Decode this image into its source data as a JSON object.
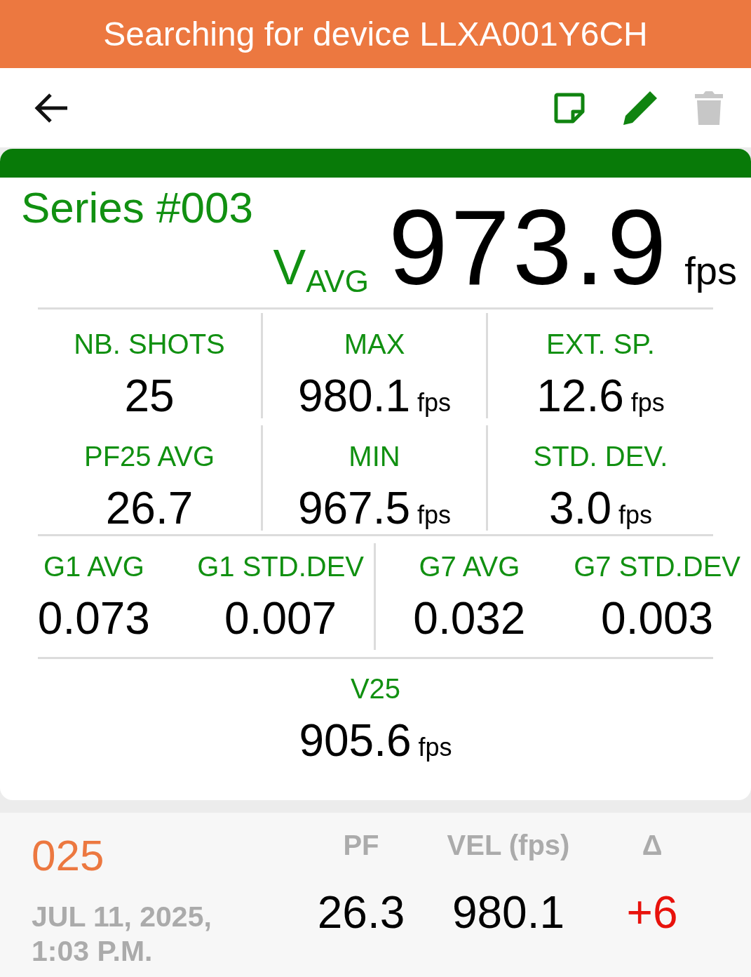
{
  "banner": {
    "text": "Searching for device LLXA001Y6CH"
  },
  "series": {
    "title": "Series #003",
    "average_label": "V$_{AVG}$",
    "average_value": "973.9",
    "average_unit": "fps"
  },
  "stats": [
    {
      "label": "NB. SHOTS",
      "value": "25"
    },
    {
      "label": "MAX",
      "value": "980.1",
      "unit": "fps"
    },
    {
      "label": "EXT. SP.",
      "value": "12.6",
      "unit": "fps"
    },
    {
      "label": "PF25 AVG",
      "value": "26.7"
    },
    {
      "label": "MIN",
      "value": "967.5",
      "unit": "fps"
    },
    {
      "label": "STD. DEV.",
      "value": "3.0",
      "unit": "fps"
    }
  ],
  "drag_stats": [
    {
      "label": "G1 AVG",
      "value": "0.073"
    },
    {
      "label": "G1 STD.DEV",
      "value": "0.007"
    },
    {
      "label": "G7 AVG",
      "value": "0.032"
    },
    {
      "label": "G7 STD.DEV",
      "value": "0.003"
    }
  ],
  "v25": {
    "label": "V25",
    "value": "905.6",
    "unit": "fps"
  },
  "shot": {
    "number": "025",
    "date": "JUL 11, 2025, 1:03 P.M.",
    "columns": [
      {
        "header": "PF",
        "value": "26.3",
        "kind": "plain"
      },
      {
        "header": "VEL (fps)",
        "value": "980.1",
        "kind": "plain"
      },
      {
        "header": "Δ",
        "value": "+6",
        "kind": "delta"
      }
    ]
  }
}
